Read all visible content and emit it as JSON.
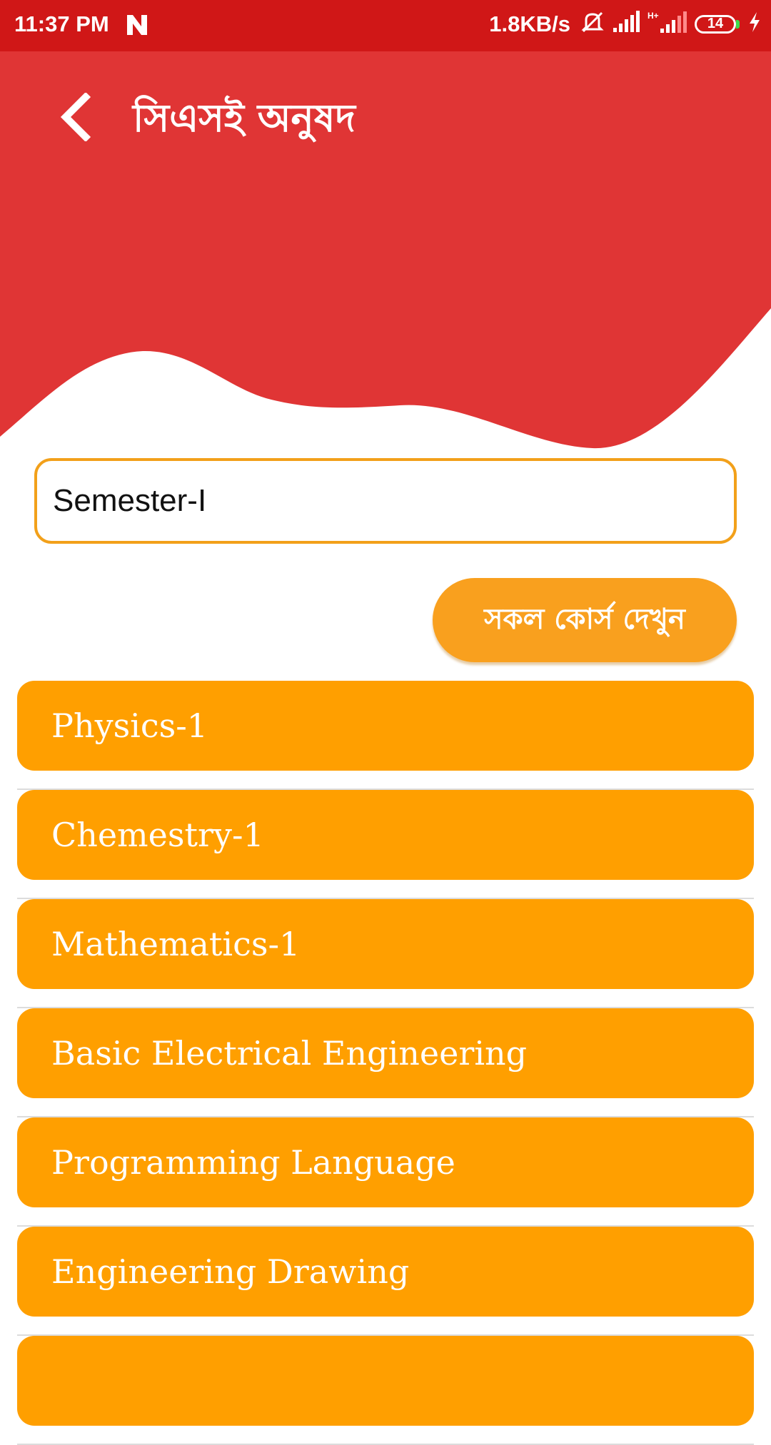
{
  "status_bar": {
    "time": "11:37 PM",
    "net_speed": "1.8KB/s",
    "battery_level": "14",
    "icons": [
      "n-notification-icon",
      "mute-icon",
      "signal-icon",
      "signal-hplus-icon",
      "battery-icon",
      "charging-icon"
    ]
  },
  "header": {
    "title": "সিএসই অনুষদ",
    "background_color": "#e03535",
    "back_icon": "back-arrow-icon"
  },
  "semester_field": {
    "value": "Semester-I"
  },
  "all_courses_button": {
    "label": "সকল কোর্স দেখুন"
  },
  "courses": [
    {
      "label": "Physics-1"
    },
    {
      "label": "Chemestry-1"
    },
    {
      "label": "Mathematics-1"
    },
    {
      "label": "Basic Electrical Engineering"
    },
    {
      "label": "Programming Language"
    },
    {
      "label": "Engineering Drawing"
    },
    {
      "label": ""
    }
  ],
  "colors": {
    "status_bar": "#d01717",
    "header": "#e03535",
    "accent_orange": "#ff9f00",
    "field_border": "#f2a01a"
  }
}
